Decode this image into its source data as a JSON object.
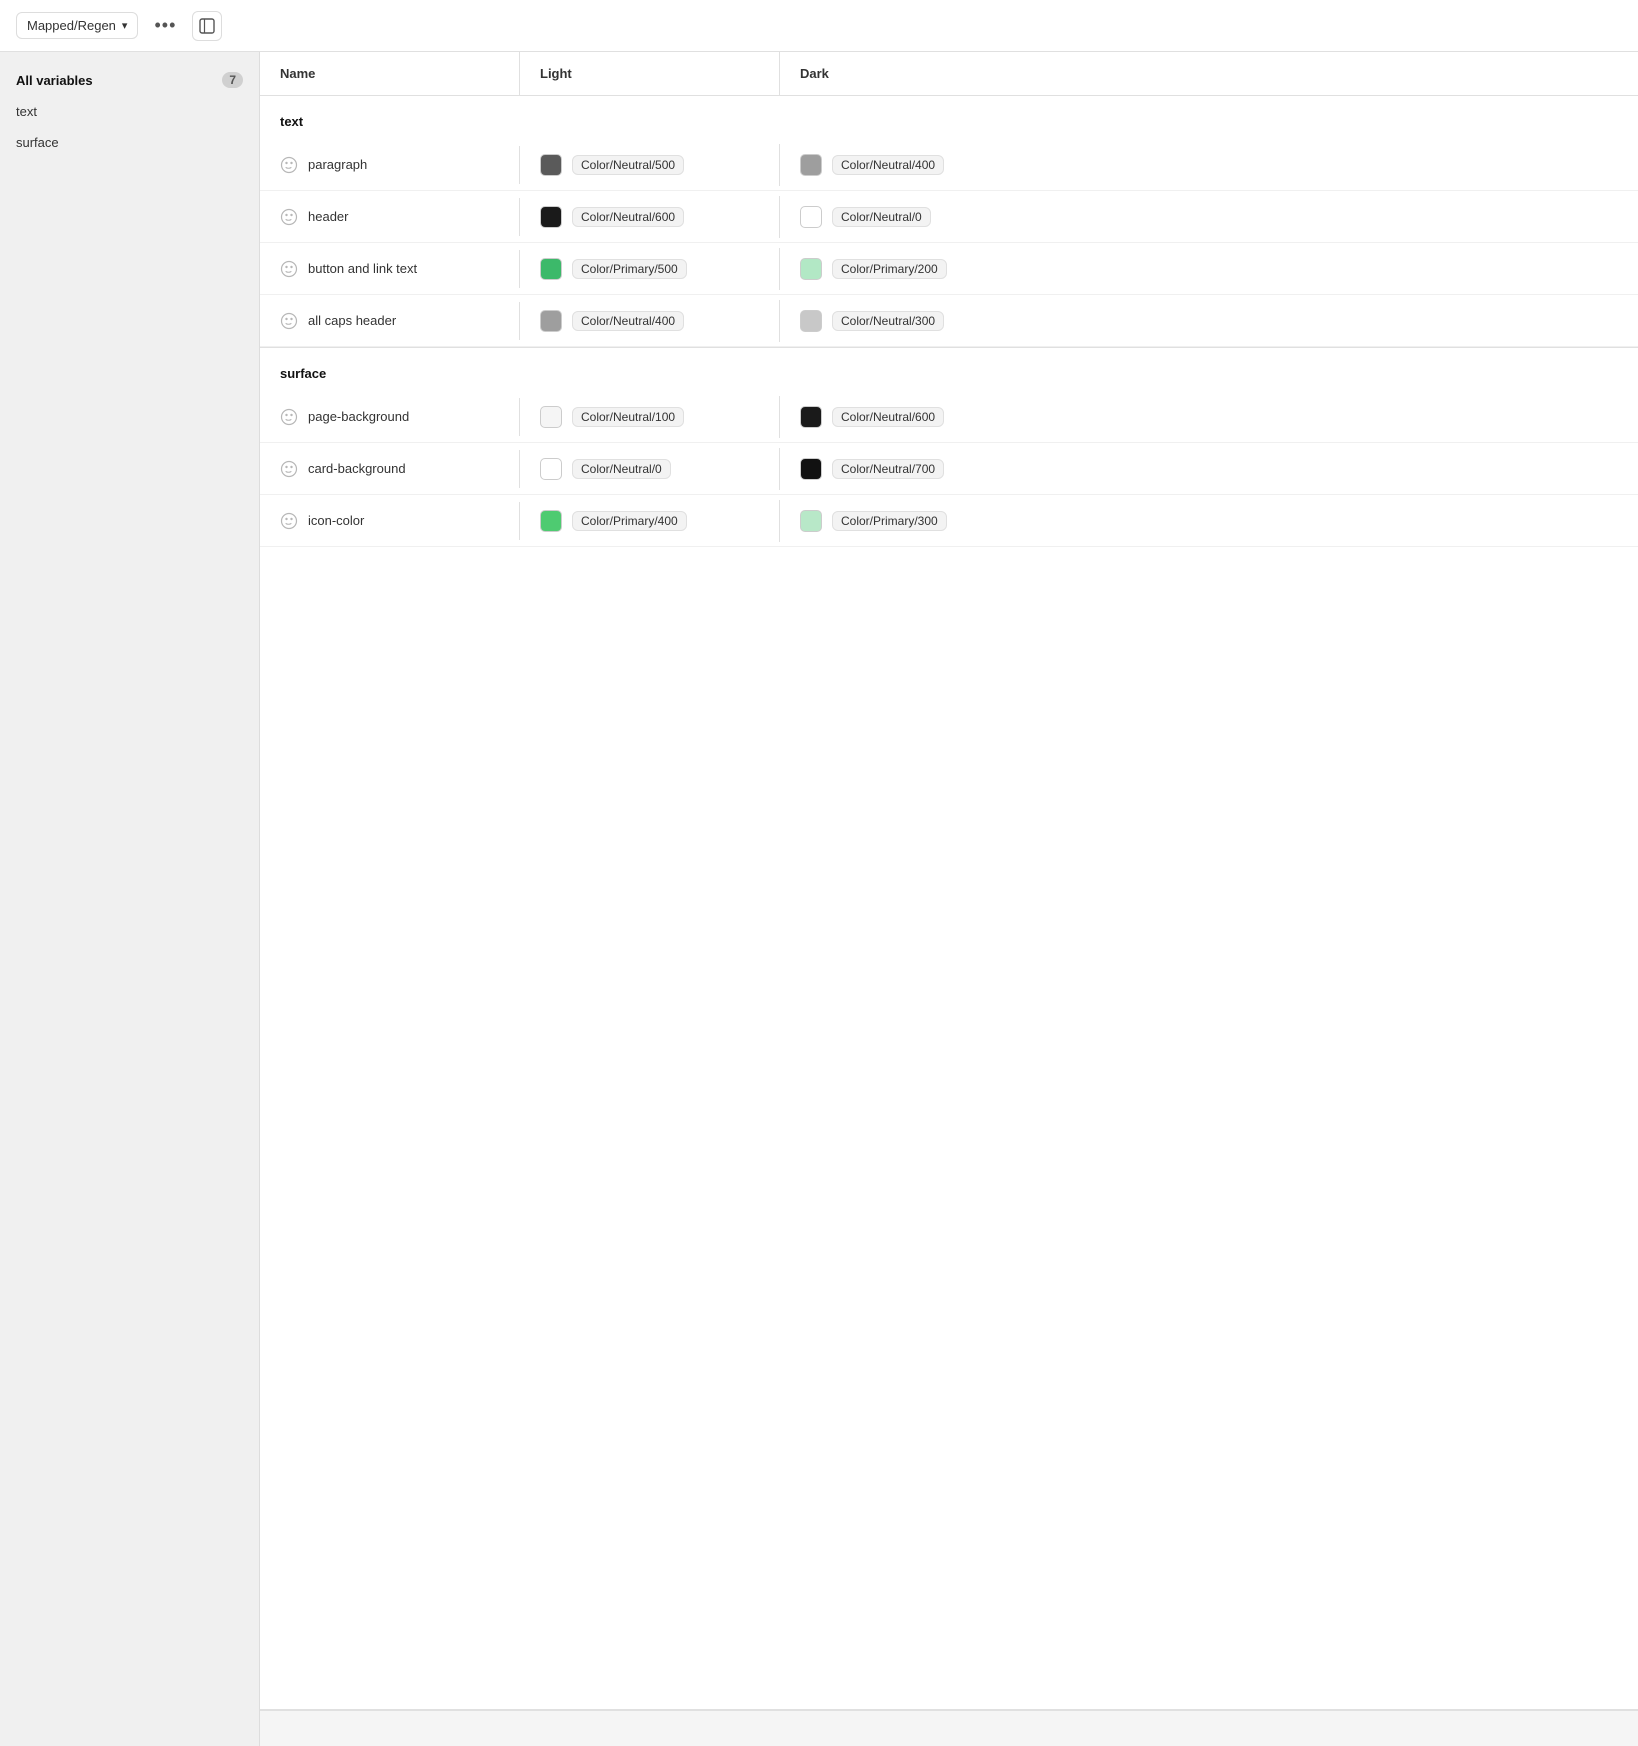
{
  "topbar": {
    "dropdown_label": "Mapped/Regen",
    "more_icon": "•••",
    "panel_icon": "⊞"
  },
  "sidebar": {
    "all_variables_label": "All variables",
    "all_variables_count": "7",
    "items": [
      {
        "label": "text"
      },
      {
        "label": "surface"
      }
    ]
  },
  "table": {
    "col_name": "Name",
    "col_light": "Light",
    "col_dark": "Dark",
    "sections": [
      {
        "label": "text",
        "rows": [
          {
            "name": "paragraph",
            "light_color": "#5a5a5a",
            "light_label": "Color/Neutral/500",
            "dark_color": "#9e9e9e",
            "dark_label": "Color/Neutral/400"
          },
          {
            "name": "header",
            "light_color": "#1a1a1a",
            "light_label": "Color/Neutral/600",
            "dark_color": "#ffffff",
            "dark_label": "Color/Neutral/0"
          },
          {
            "name": "button and link text",
            "light_color": "#3cb96a",
            "light_label": "Color/Primary/500",
            "dark_color": "#b2e8c5",
            "dark_label": "Color/Primary/200"
          },
          {
            "name": "all caps header",
            "light_color": "#9e9e9e",
            "light_label": "Color/Neutral/400",
            "dark_color": "#c8c8c8",
            "dark_label": "Color/Neutral/300"
          }
        ]
      },
      {
        "label": "surface",
        "rows": [
          {
            "name": "page-background",
            "light_color": "#f5f5f5",
            "light_label": "Color/Neutral/100",
            "dark_color": "#1a1a1a",
            "dark_label": "Color/Neutral/600"
          },
          {
            "name": "card-background",
            "light_color": "#ffffff",
            "light_label": "Color/Neutral/0",
            "dark_color": "#111111",
            "dark_label": "Color/Neutral/700"
          },
          {
            "name": "icon-color",
            "light_color": "#4ecb71",
            "light_label": "Color/Primary/400",
            "dark_color": "#b8e8c8",
            "dark_label": "Color/Primary/300"
          }
        ]
      }
    ]
  }
}
